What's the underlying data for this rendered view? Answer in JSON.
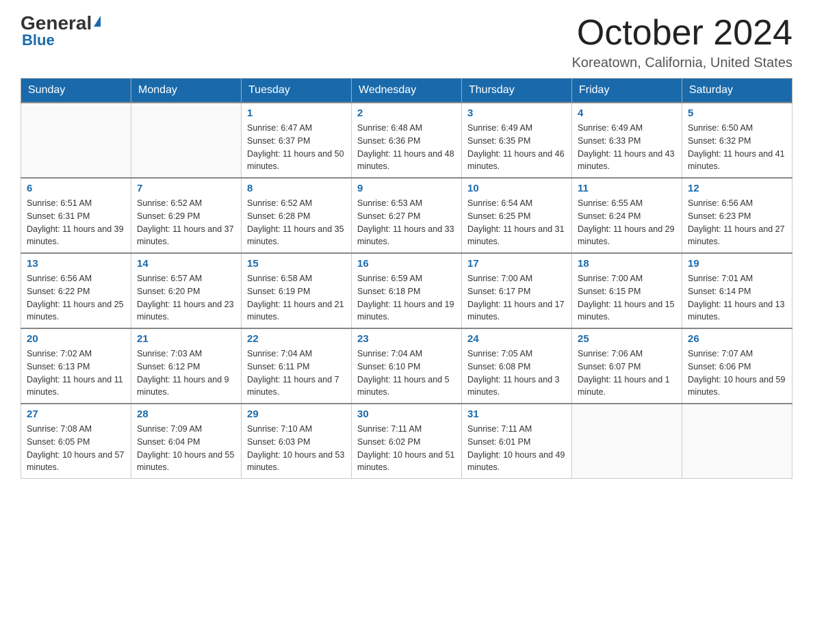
{
  "header": {
    "logo_general": "General",
    "logo_triangle": "▶",
    "logo_blue": "Blue",
    "title": "October 2024",
    "location": "Koreatown, California, United States"
  },
  "weekdays": [
    "Sunday",
    "Monday",
    "Tuesday",
    "Wednesday",
    "Thursday",
    "Friday",
    "Saturday"
  ],
  "weeks": [
    [
      {
        "day": "",
        "sunrise": "",
        "sunset": "",
        "daylight": ""
      },
      {
        "day": "",
        "sunrise": "",
        "sunset": "",
        "daylight": ""
      },
      {
        "day": "1",
        "sunrise": "Sunrise: 6:47 AM",
        "sunset": "Sunset: 6:37 PM",
        "daylight": "Daylight: 11 hours and 50 minutes."
      },
      {
        "day": "2",
        "sunrise": "Sunrise: 6:48 AM",
        "sunset": "Sunset: 6:36 PM",
        "daylight": "Daylight: 11 hours and 48 minutes."
      },
      {
        "day": "3",
        "sunrise": "Sunrise: 6:49 AM",
        "sunset": "Sunset: 6:35 PM",
        "daylight": "Daylight: 11 hours and 46 minutes."
      },
      {
        "day": "4",
        "sunrise": "Sunrise: 6:49 AM",
        "sunset": "Sunset: 6:33 PM",
        "daylight": "Daylight: 11 hours and 43 minutes."
      },
      {
        "day": "5",
        "sunrise": "Sunrise: 6:50 AM",
        "sunset": "Sunset: 6:32 PM",
        "daylight": "Daylight: 11 hours and 41 minutes."
      }
    ],
    [
      {
        "day": "6",
        "sunrise": "Sunrise: 6:51 AM",
        "sunset": "Sunset: 6:31 PM",
        "daylight": "Daylight: 11 hours and 39 minutes."
      },
      {
        "day": "7",
        "sunrise": "Sunrise: 6:52 AM",
        "sunset": "Sunset: 6:29 PM",
        "daylight": "Daylight: 11 hours and 37 minutes."
      },
      {
        "day": "8",
        "sunrise": "Sunrise: 6:52 AM",
        "sunset": "Sunset: 6:28 PM",
        "daylight": "Daylight: 11 hours and 35 minutes."
      },
      {
        "day": "9",
        "sunrise": "Sunrise: 6:53 AM",
        "sunset": "Sunset: 6:27 PM",
        "daylight": "Daylight: 11 hours and 33 minutes."
      },
      {
        "day": "10",
        "sunrise": "Sunrise: 6:54 AM",
        "sunset": "Sunset: 6:25 PM",
        "daylight": "Daylight: 11 hours and 31 minutes."
      },
      {
        "day": "11",
        "sunrise": "Sunrise: 6:55 AM",
        "sunset": "Sunset: 6:24 PM",
        "daylight": "Daylight: 11 hours and 29 minutes."
      },
      {
        "day": "12",
        "sunrise": "Sunrise: 6:56 AM",
        "sunset": "Sunset: 6:23 PM",
        "daylight": "Daylight: 11 hours and 27 minutes."
      }
    ],
    [
      {
        "day": "13",
        "sunrise": "Sunrise: 6:56 AM",
        "sunset": "Sunset: 6:22 PM",
        "daylight": "Daylight: 11 hours and 25 minutes."
      },
      {
        "day": "14",
        "sunrise": "Sunrise: 6:57 AM",
        "sunset": "Sunset: 6:20 PM",
        "daylight": "Daylight: 11 hours and 23 minutes."
      },
      {
        "day": "15",
        "sunrise": "Sunrise: 6:58 AM",
        "sunset": "Sunset: 6:19 PM",
        "daylight": "Daylight: 11 hours and 21 minutes."
      },
      {
        "day": "16",
        "sunrise": "Sunrise: 6:59 AM",
        "sunset": "Sunset: 6:18 PM",
        "daylight": "Daylight: 11 hours and 19 minutes."
      },
      {
        "day": "17",
        "sunrise": "Sunrise: 7:00 AM",
        "sunset": "Sunset: 6:17 PM",
        "daylight": "Daylight: 11 hours and 17 minutes."
      },
      {
        "day": "18",
        "sunrise": "Sunrise: 7:00 AM",
        "sunset": "Sunset: 6:15 PM",
        "daylight": "Daylight: 11 hours and 15 minutes."
      },
      {
        "day": "19",
        "sunrise": "Sunrise: 7:01 AM",
        "sunset": "Sunset: 6:14 PM",
        "daylight": "Daylight: 11 hours and 13 minutes."
      }
    ],
    [
      {
        "day": "20",
        "sunrise": "Sunrise: 7:02 AM",
        "sunset": "Sunset: 6:13 PM",
        "daylight": "Daylight: 11 hours and 11 minutes."
      },
      {
        "day": "21",
        "sunrise": "Sunrise: 7:03 AM",
        "sunset": "Sunset: 6:12 PM",
        "daylight": "Daylight: 11 hours and 9 minutes."
      },
      {
        "day": "22",
        "sunrise": "Sunrise: 7:04 AM",
        "sunset": "Sunset: 6:11 PM",
        "daylight": "Daylight: 11 hours and 7 minutes."
      },
      {
        "day": "23",
        "sunrise": "Sunrise: 7:04 AM",
        "sunset": "Sunset: 6:10 PM",
        "daylight": "Daylight: 11 hours and 5 minutes."
      },
      {
        "day": "24",
        "sunrise": "Sunrise: 7:05 AM",
        "sunset": "Sunset: 6:08 PM",
        "daylight": "Daylight: 11 hours and 3 minutes."
      },
      {
        "day": "25",
        "sunrise": "Sunrise: 7:06 AM",
        "sunset": "Sunset: 6:07 PM",
        "daylight": "Daylight: 11 hours and 1 minute."
      },
      {
        "day": "26",
        "sunrise": "Sunrise: 7:07 AM",
        "sunset": "Sunset: 6:06 PM",
        "daylight": "Daylight: 10 hours and 59 minutes."
      }
    ],
    [
      {
        "day": "27",
        "sunrise": "Sunrise: 7:08 AM",
        "sunset": "Sunset: 6:05 PM",
        "daylight": "Daylight: 10 hours and 57 minutes."
      },
      {
        "day": "28",
        "sunrise": "Sunrise: 7:09 AM",
        "sunset": "Sunset: 6:04 PM",
        "daylight": "Daylight: 10 hours and 55 minutes."
      },
      {
        "day": "29",
        "sunrise": "Sunrise: 7:10 AM",
        "sunset": "Sunset: 6:03 PM",
        "daylight": "Daylight: 10 hours and 53 minutes."
      },
      {
        "day": "30",
        "sunrise": "Sunrise: 7:11 AM",
        "sunset": "Sunset: 6:02 PM",
        "daylight": "Daylight: 10 hours and 51 minutes."
      },
      {
        "day": "31",
        "sunrise": "Sunrise: 7:11 AM",
        "sunset": "Sunset: 6:01 PM",
        "daylight": "Daylight: 10 hours and 49 minutes."
      },
      {
        "day": "",
        "sunrise": "",
        "sunset": "",
        "daylight": ""
      },
      {
        "day": "",
        "sunrise": "",
        "sunset": "",
        "daylight": ""
      }
    ]
  ]
}
